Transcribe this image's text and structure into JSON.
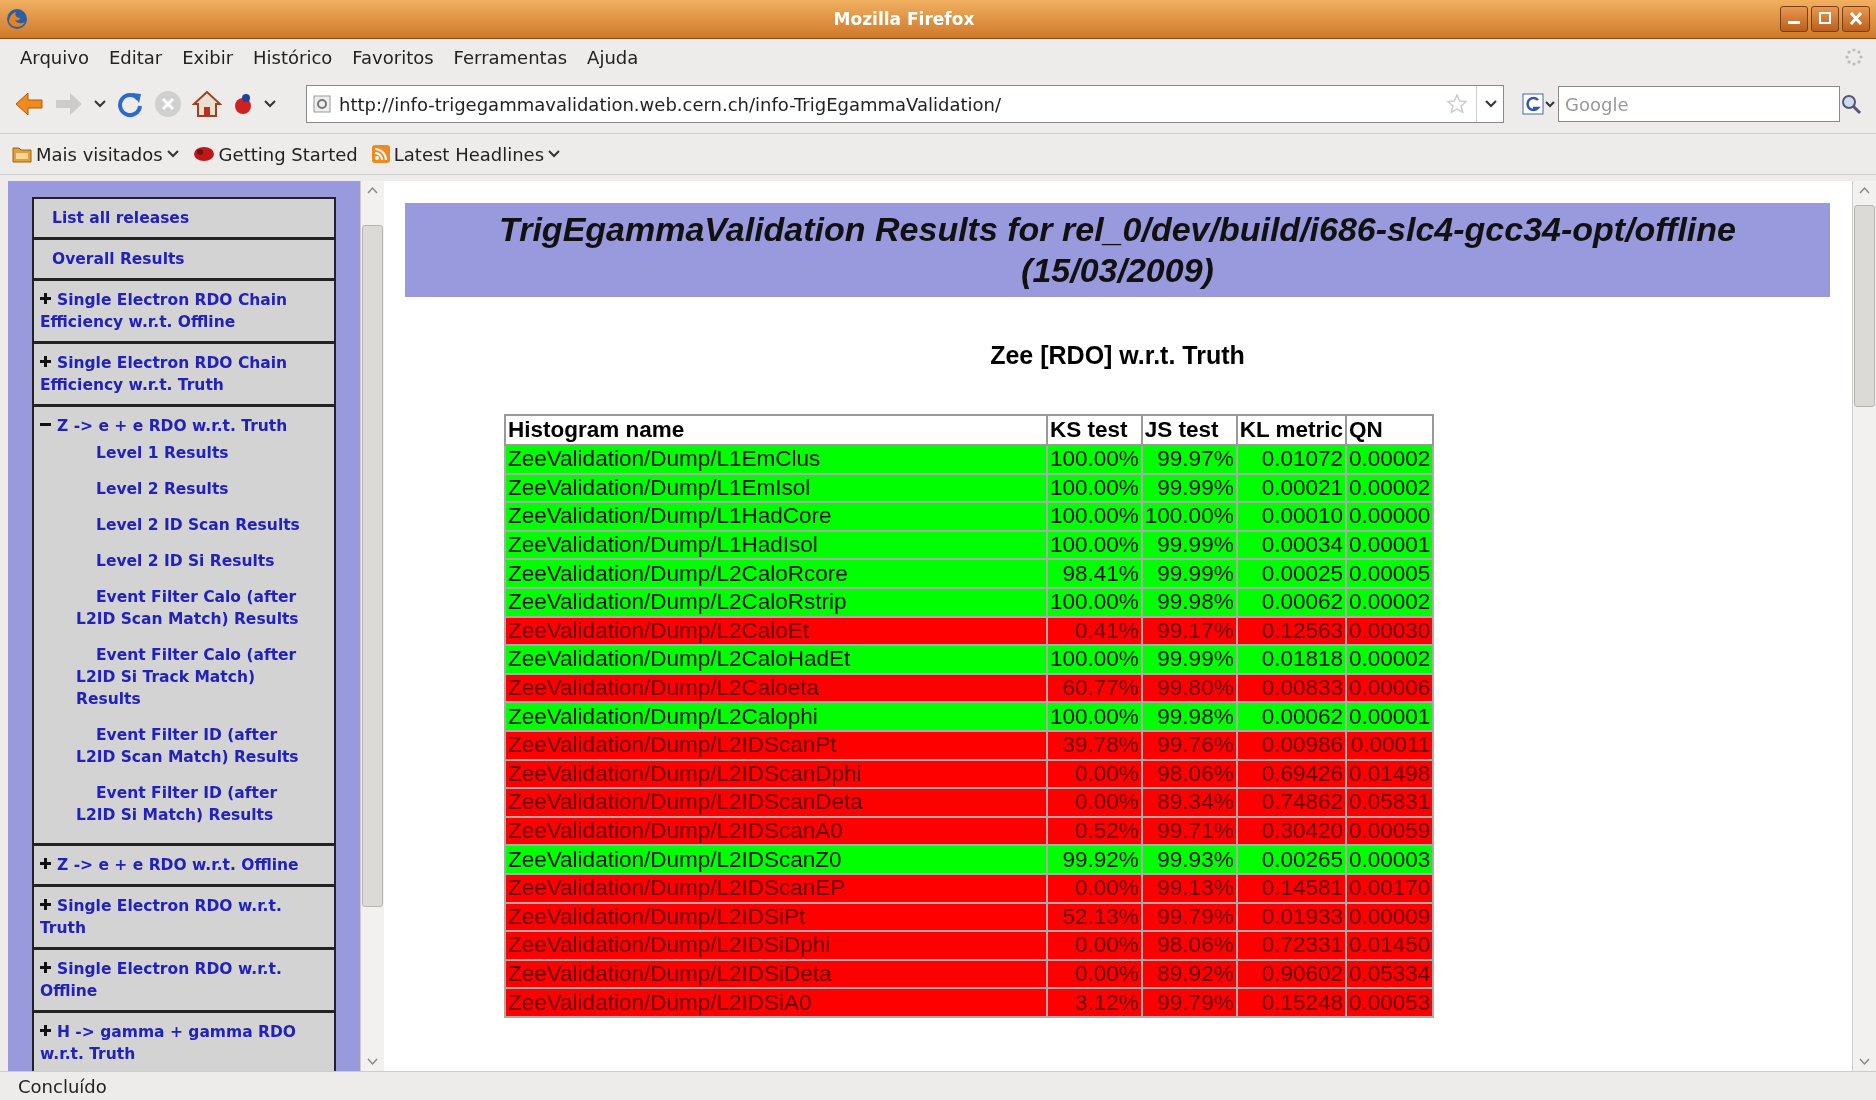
{
  "window": {
    "title": "Mozilla Firefox"
  },
  "menu": [
    "Arquivo",
    "Editar",
    "Exibir",
    "Histórico",
    "Favoritos",
    "Ferramentas",
    "Ajuda"
  ],
  "toolbar": {
    "url": "http://info-trigegammavalidation.web.cern.ch/info-TrigEgammaValidation/",
    "search": {
      "placeholder": "Google"
    }
  },
  "bookmarks": [
    {
      "label": "Mais visitados",
      "kind": "folder"
    },
    {
      "label": "Getting Started",
      "kind": "page"
    },
    {
      "label": "Latest Headlines",
      "kind": "feed"
    }
  ],
  "sidebar": {
    "items": [
      {
        "label": "List all releases",
        "kind": "link"
      },
      {
        "label": "Overall Results",
        "kind": "link"
      },
      {
        "label": "Single Electron RDO Chain Efficiency w.r.t. Offline",
        "kind": "group",
        "expanded": false
      },
      {
        "label": "Single Electron RDO Chain Efficiency w.r.t. Truth",
        "kind": "group",
        "expanded": false
      },
      {
        "label": "Z -> e + e RDO w.r.t. Truth",
        "kind": "group",
        "expanded": true,
        "children": [
          {
            "label": "Level 1 Results"
          },
          {
            "label": "Level 2 Results"
          },
          {
            "label": "Level 2 ID Scan Results"
          },
          {
            "label": "Level 2 ID Si Results"
          },
          {
            "label": "Event Filter Calo (after L2ID Scan Match) Results"
          },
          {
            "label": "Event Filter Calo (after L2ID Si Track Match) Results"
          },
          {
            "label": "Event Filter ID (after L2ID Scan Match) Results"
          },
          {
            "label": "Event Filter ID (after L2ID Si Match) Results"
          }
        ]
      },
      {
        "label": "Z -> e + e RDO w.r.t. Offline",
        "kind": "group",
        "expanded": false
      },
      {
        "label": "Single Electron RDO w.r.t. Truth",
        "kind": "group",
        "expanded": false
      },
      {
        "label": "Single Electron RDO w.r.t. Offline",
        "kind": "group",
        "expanded": false
      },
      {
        "label": "H -> gamma + gamma RDO w.r.t. Truth",
        "kind": "group",
        "expanded": false
      }
    ]
  },
  "page": {
    "title": "TrigEgammaValidation Results for rel_0/dev/build/i686-slc4-gcc34-opt/offline (15/03/2009)",
    "subtitle": "Zee [RDO] w.r.t. Truth",
    "table": {
      "columns": [
        "Histogram name",
        "KS test",
        "JS test",
        "KL metric",
        "QN"
      ],
      "rows": [
        {
          "cells": [
            "ZeeValidation/Dump/L1EmClus",
            "100.00%",
            "99.97%",
            "0.01072",
            "0.00002"
          ],
          "color": "#00ff00"
        },
        {
          "cells": [
            "ZeeValidation/Dump/L1EmIsol",
            "100.00%",
            "99.99%",
            "0.00021",
            "0.00002"
          ],
          "color": "#00ff00"
        },
        {
          "cells": [
            "ZeeValidation/Dump/L1HadCore",
            "100.00%",
            "100.00%",
            "0.00010",
            "0.00000"
          ],
          "color": "#00ff00"
        },
        {
          "cells": [
            "ZeeValidation/Dump/L1HadIsol",
            "100.00%",
            "99.99%",
            "0.00034",
            "0.00001"
          ],
          "color": "#00ff00"
        },
        {
          "cells": [
            "ZeeValidation/Dump/L2CaloRcore",
            "98.41%",
            "99.99%",
            "0.00025",
            "0.00005"
          ],
          "color": "#00ff00"
        },
        {
          "cells": [
            "ZeeValidation/Dump/L2CaloRstrip",
            "100.00%",
            "99.98%",
            "0.00062",
            "0.00002"
          ],
          "color": "#00ff00"
        },
        {
          "cells": [
            "ZeeValidation/Dump/L2CaloEt",
            "0.41%",
            "99.17%",
            "0.12563",
            "0.00030"
          ],
          "color": "#ff0000"
        },
        {
          "cells": [
            "ZeeValidation/Dump/L2CaloHadEt",
            "100.00%",
            "99.99%",
            "0.01818",
            "0.00002"
          ],
          "color": "#00ff00"
        },
        {
          "cells": [
            "ZeeValidation/Dump/L2Caloeta",
            "60.77%",
            "99.80%",
            "0.00833",
            "0.00006"
          ],
          "color": "#ff0000"
        },
        {
          "cells": [
            "ZeeValidation/Dump/L2Calophi",
            "100.00%",
            "99.98%",
            "0.00062",
            "0.00001"
          ],
          "color": "#00ff00"
        },
        {
          "cells": [
            "ZeeValidation/Dump/L2IDScanPt",
            "39.78%",
            "99.76%",
            "0.00986",
            "0.00011"
          ],
          "color": "#ff0000"
        },
        {
          "cells": [
            "ZeeValidation/Dump/L2IDScanDphi",
            "0.00%",
            "98.06%",
            "0.69426",
            "0.01498"
          ],
          "color": "#ff0000"
        },
        {
          "cells": [
            "ZeeValidation/Dump/L2IDScanDeta",
            "0.00%",
            "89.34%",
            "0.74862",
            "0.05831"
          ],
          "color": "#ff0000"
        },
        {
          "cells": [
            "ZeeValidation/Dump/L2IDScanA0",
            "0.52%",
            "99.71%",
            "0.30420",
            "0.00059"
          ],
          "color": "#ff0000"
        },
        {
          "cells": [
            "ZeeValidation/Dump/L2IDScanZ0",
            "99.92%",
            "99.93%",
            "0.00265",
            "0.00003"
          ],
          "color": "#00ff00"
        },
        {
          "cells": [
            "ZeeValidation/Dump/L2IDScanEP",
            "0.00%",
            "99.13%",
            "0.14581",
            "0.00170"
          ],
          "color": "#ff0000"
        },
        {
          "cells": [
            "ZeeValidation/Dump/L2IDSiPt",
            "52.13%",
            "99.79%",
            "0.01933",
            "0.00009"
          ],
          "color": "#ff0000"
        },
        {
          "cells": [
            "ZeeValidation/Dump/L2IDSiDphi",
            "0.00%",
            "98.06%",
            "0.72331",
            "0.01450"
          ],
          "color": "#ff0000"
        },
        {
          "cells": [
            "ZeeValidation/Dump/L2IDSiDeta",
            "0.00%",
            "89.92%",
            "0.90602",
            "0.05334"
          ],
          "color": "#ff0000"
        },
        {
          "cells": [
            "ZeeValidation/Dump/L2IDSiA0",
            "3.12%",
            "99.79%",
            "0.15248",
            "0.00053"
          ],
          "color": "#ff0000"
        }
      ]
    }
  },
  "status_bar": {
    "text": "Concluído"
  }
}
